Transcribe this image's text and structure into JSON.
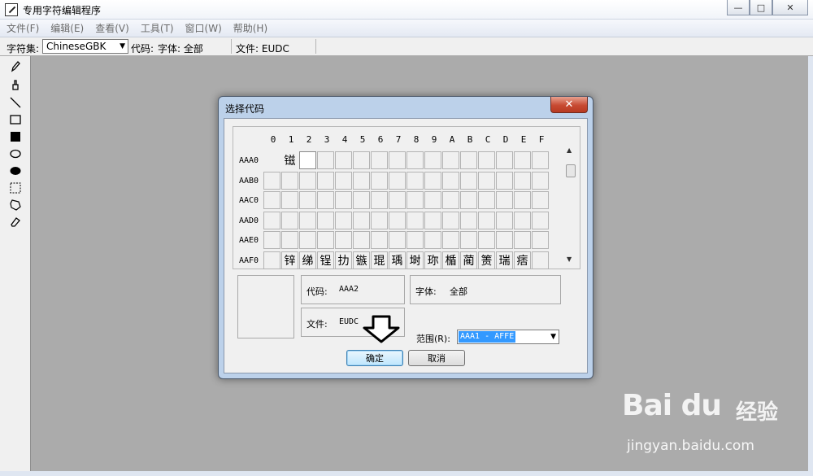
{
  "window": {
    "title": "专用字符编辑程序",
    "controls": [
      "—",
      "□",
      "✕"
    ]
  },
  "menu": [
    {
      "label": "文件(F)"
    },
    {
      "label": "编辑(E)"
    },
    {
      "label": "查看(V)"
    },
    {
      "label": "工具(T)"
    },
    {
      "label": "窗口(W)"
    },
    {
      "label": "帮助(H)"
    }
  ],
  "toolbar": {
    "charset_label": "字符集:",
    "charset_value": "ChineseGBK",
    "code_label": "代码:",
    "font_label": "字体: 全部",
    "file_label": "文件: EUDC"
  },
  "tools": [
    "pencil-icon",
    "brush-icon",
    "line-icon",
    "rectangle-icon",
    "filled-rectangle-icon",
    "ellipse-icon",
    "filled-ellipse-icon",
    "rect-select-icon",
    "freeform-select-icon",
    "eraser-icon"
  ],
  "dialog": {
    "title": "选择代码",
    "close": "✕",
    "columns": [
      "0",
      "1",
      "2",
      "3",
      "4",
      "5",
      "6",
      "7",
      "8",
      "9",
      "A",
      "B",
      "C",
      "D",
      "E",
      "F"
    ],
    "rows": [
      {
        "label": "AAA0",
        "cells": [
          "",
          "镃",
          "",
          "",
          "",
          "",
          "",
          "",
          "",
          "",
          "",
          "",
          "",
          "",
          "",
          ""
        ]
      },
      {
        "label": "AAB0",
        "cells": [
          "",
          "",
          "",
          "",
          "",
          "",
          "",
          "",
          "",
          "",
          "",
          "",
          "",
          "",
          "",
          ""
        ]
      },
      {
        "label": "AAC0",
        "cells": [
          "",
          "",
          "",
          "",
          "",
          "",
          "",
          "",
          "",
          "",
          "",
          "",
          "",
          "",
          "",
          ""
        ]
      },
      {
        "label": "AAD0",
        "cells": [
          "",
          "",
          "",
          "",
          "",
          "",
          "",
          "",
          "",
          "",
          "",
          "",
          "",
          "",
          "",
          ""
        ]
      },
      {
        "label": "AAE0",
        "cells": [
          "",
          "",
          "",
          "",
          "",
          "",
          "",
          "",
          "",
          "",
          "",
          "",
          "",
          "",
          "",
          ""
        ]
      },
      {
        "label": "AAF0",
        "cells": [
          "",
          "锌",
          "绨",
          "锃",
          "扐",
          "镞",
          "琨",
          "瑀",
          "埘",
          "珎",
          "楯",
          "蔺",
          "箦",
          "瑞",
          "痞",
          ""
        ]
      }
    ],
    "selected": {
      "row": 0,
      "col": 2
    },
    "code_label": "代码:",
    "code_value": "AAA2",
    "font_label": "字体:",
    "font_value": "全部",
    "file_label": "文件:",
    "file_value": "EUDC",
    "range_label": "范围(R):",
    "range_value": "AAA1 - AFFE",
    "ok_label": "确定",
    "cancel_label": "取消"
  },
  "watermark": {
    "logo": "Bai du",
    "cn": "经验",
    "url": "jingyan.baidu.com"
  }
}
